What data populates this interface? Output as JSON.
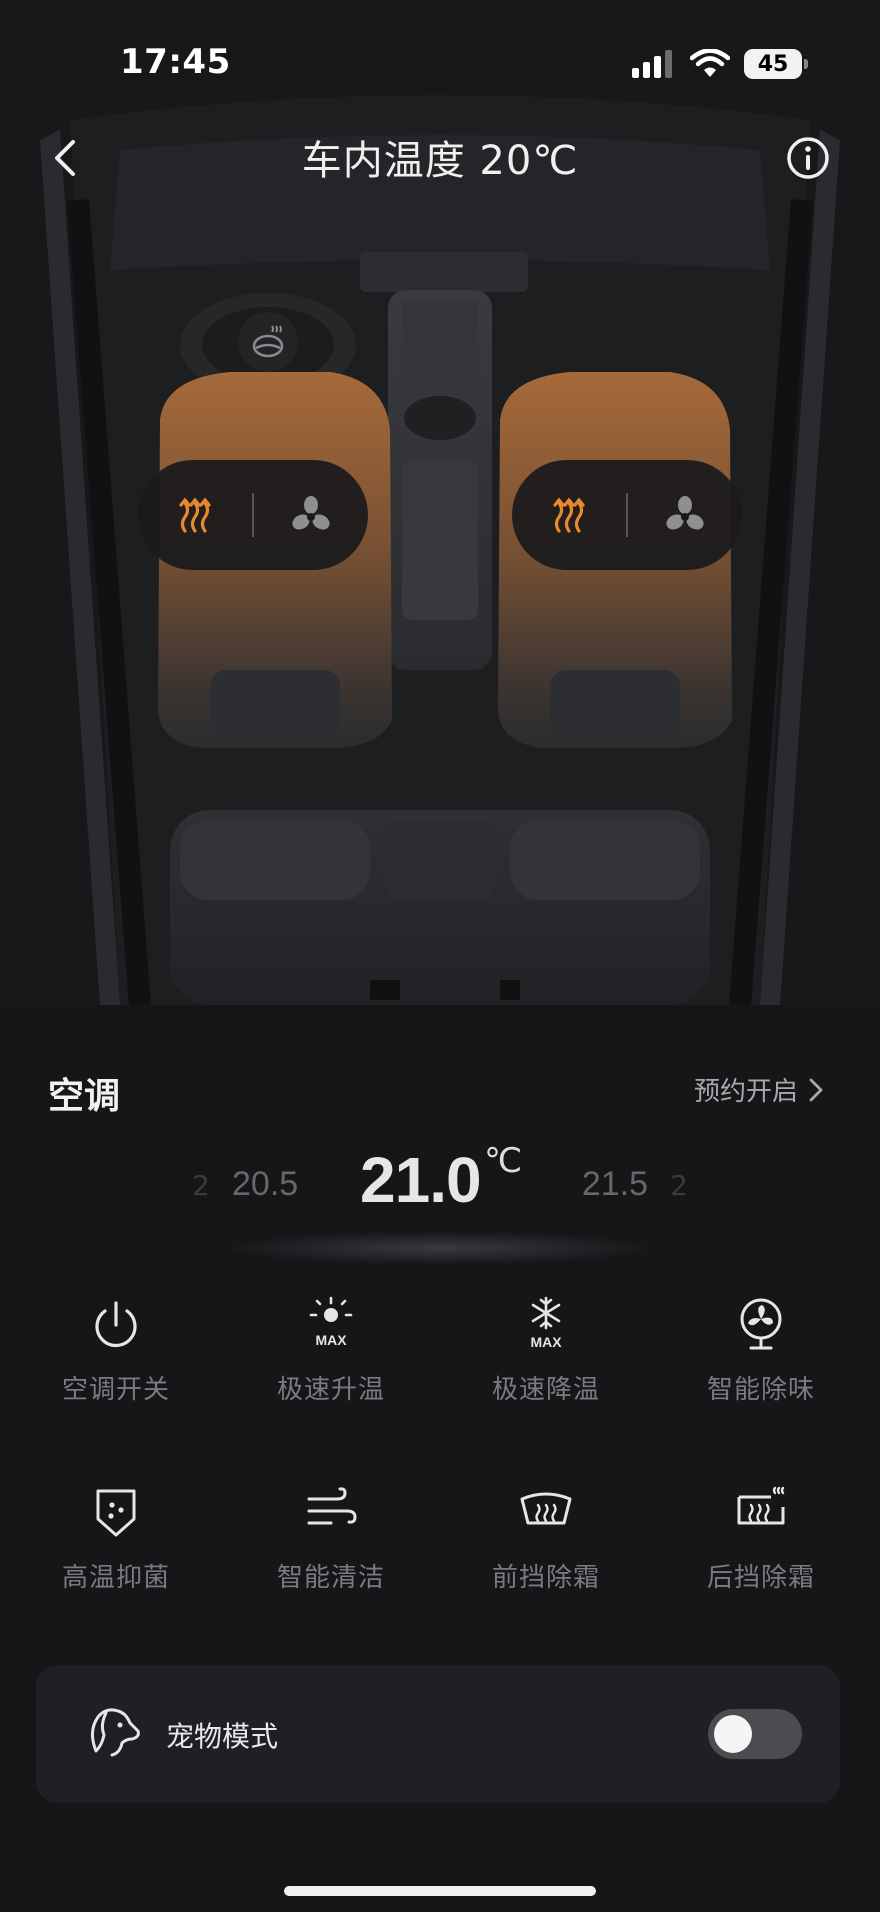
{
  "status_bar": {
    "time": "17:45",
    "battery": "45"
  },
  "header": {
    "title": "车内温度 20℃"
  },
  "seats": {
    "left": {
      "heat_icon": "seat-heat-icon",
      "vent_icon": "seat-ventilation-icon"
    },
    "right": {
      "heat_icon": "seat-heat-icon",
      "vent_icon": "seat-ventilation-icon"
    }
  },
  "climate": {
    "title": "空调",
    "schedule_label": "预约开启",
    "temperature": {
      "current": "21.0",
      "unit": "℃",
      "previous": "20.5",
      "next": "21.5",
      "edge_left": "2",
      "edge_right": "2"
    },
    "controls": [
      {
        "label": "空调开关",
        "icon": "power-icon"
      },
      {
        "label": "极速升温",
        "icon": "max-heat-icon"
      },
      {
        "label": "极速降温",
        "icon": "max-cool-icon"
      },
      {
        "label": "智能除味",
        "icon": "fan-icon"
      },
      {
        "label": "高温抑菌",
        "icon": "sterilize-icon"
      },
      {
        "label": "智能清洁",
        "icon": "wind-clean-icon"
      },
      {
        "label": "前挡除霜",
        "icon": "front-defrost-icon"
      },
      {
        "label": "后挡除霜",
        "icon": "rear-defrost-icon"
      }
    ]
  },
  "pet_mode": {
    "label": "宠物模式",
    "enabled": false
  },
  "colors": {
    "accent_heat": "#e8892c",
    "background": "#151618",
    "card": "#1f2023"
  }
}
